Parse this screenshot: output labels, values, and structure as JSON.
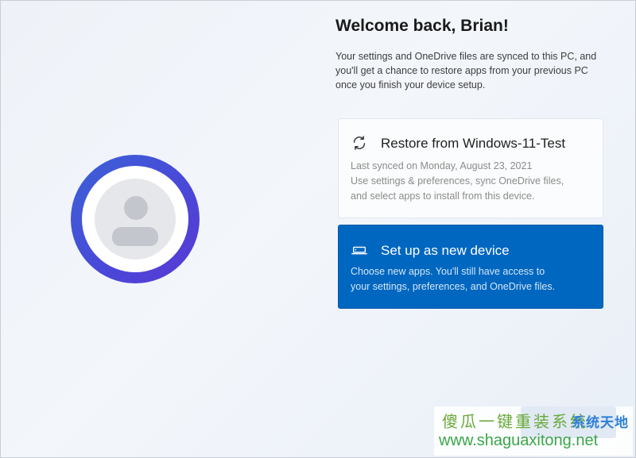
{
  "title": "Welcome back, Brian!",
  "description": "Your settings and OneDrive files are synced to this PC, and you'll get a chance to restore apps from your previous PC once you finish your device setup.",
  "options": {
    "restore": {
      "icon": "sync-icon",
      "title": "Restore from Windows-11-Test",
      "lines": [
        "Last synced on Monday, August 23, 2021",
        "Use settings & preferences, sync OneDrive files,",
        "and select apps to install from this device."
      ]
    },
    "new_device": {
      "icon": "laptop-icon",
      "title": "Set up as new device",
      "lines": [
        "Choose new apps. You'll still have access to",
        "your settings, preferences, and OneDrive files."
      ],
      "selected": true
    }
  },
  "colors": {
    "accent": "#0067c0",
    "avatar_ring": "#4a47d8"
  },
  "watermark": {
    "title": "傻瓜一键重装系统",
    "logo_text": "系统天地",
    "url": "www.shaguaxitong.net"
  }
}
